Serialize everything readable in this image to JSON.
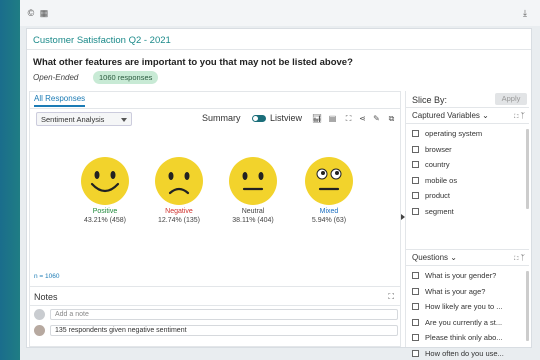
{
  "topbar": {
    "icons": [
      "copyright-icon",
      "grid-icon",
      "download-icon"
    ]
  },
  "card": {
    "title": "Customer Satisfaction Q2 - 2021",
    "question": "What other features are important to you that may not be listed above?",
    "question_type": "Open-Ended",
    "responses_badge": "1060 responses"
  },
  "panel": {
    "tab": "All Responses",
    "analysis_select": "Sentiment Analysis",
    "summary_label": "Summary",
    "listview_label": "Listview",
    "n_label": "n = 1060"
  },
  "sentiments": [
    {
      "label": "Positive",
      "stats": "43.21% (458)",
      "color": "#1f8a3b",
      "share": 43.21,
      "count": 458
    },
    {
      "label": "Negative",
      "stats": "12.74% (135)",
      "color": "#d0312d",
      "share": 12.74,
      "count": 135
    },
    {
      "label": "Neutral",
      "stats": "38.11% (404)",
      "color": "#444444",
      "share": 38.11,
      "count": 404
    },
    {
      "label": "Mixed",
      "stats": "5.94% (63)",
      "color": "#1b6fc2",
      "share": 5.94,
      "count": 63
    }
  ],
  "notes": {
    "title": "Notes",
    "add_placeholder": "Add a note",
    "items": [
      "135 respondents given negative sentiment"
    ]
  },
  "slice": {
    "title": "Slice By:",
    "apply_label": "Apply",
    "captured_header": "Captured Variables",
    "captured_items": [
      "operating system",
      "browser",
      "country",
      "mobile os",
      "product",
      "segment"
    ],
    "questions_header": "Questions",
    "question_items": [
      "What is your gender?",
      "What is your age?",
      "How likely are you to ...",
      "Are you currently a st...",
      "Please think only abo...",
      "How often do you use..."
    ]
  },
  "colors": {
    "accent": "#1b8a8a",
    "face": "#f2d32c"
  }
}
